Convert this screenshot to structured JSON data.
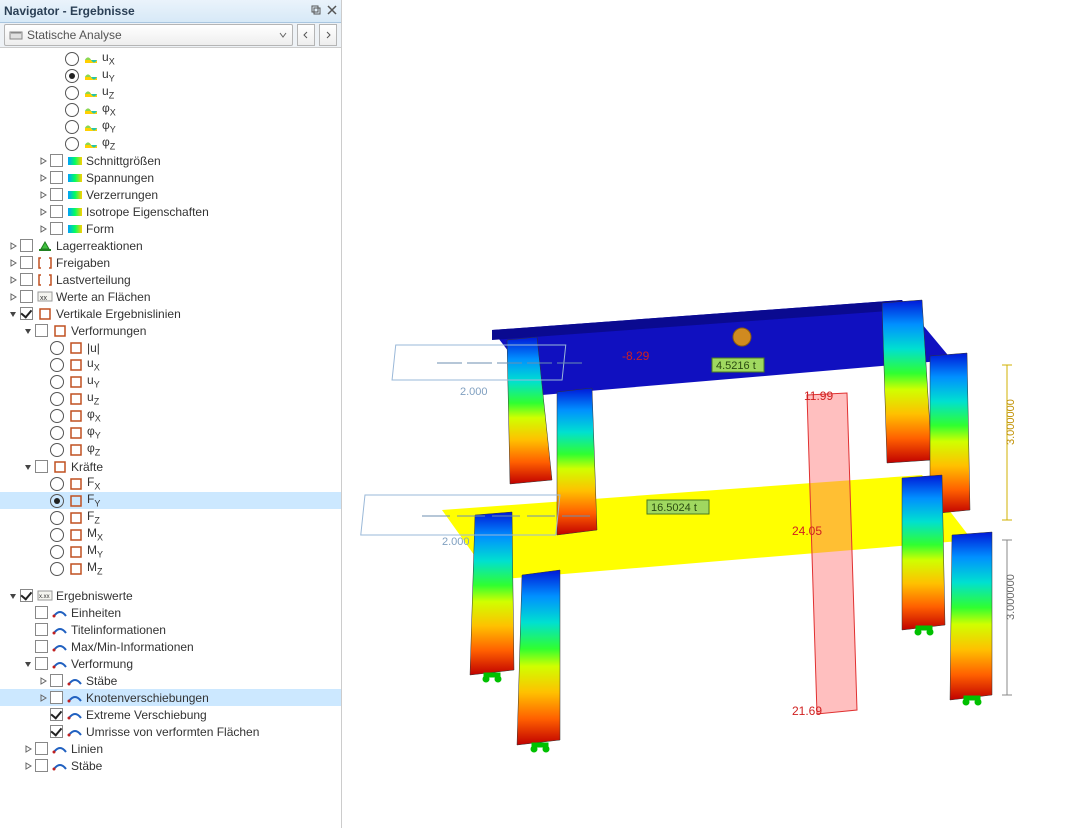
{
  "panel": {
    "title": "Navigator - Ergebnisse",
    "dropdown": "Statische Analyse"
  },
  "tree": [
    {
      "type": "radio",
      "indent": 3,
      "label": "u",
      "sub": "X"
    },
    {
      "type": "radio",
      "indent": 3,
      "label": "u",
      "sub": "Y",
      "radioChecked": true
    },
    {
      "type": "radio",
      "indent": 3,
      "label": "u",
      "sub": "Z"
    },
    {
      "type": "radio",
      "indent": 3,
      "label": "φ",
      "sub": "X"
    },
    {
      "type": "radio",
      "indent": 3,
      "label": "φ",
      "sub": "Y"
    },
    {
      "type": "radio",
      "indent": 3,
      "label": "φ",
      "sub": "Z"
    },
    {
      "type": "check",
      "indent": 2,
      "expander": "closed",
      "label": "Schnittgrößen",
      "icon": "gradient"
    },
    {
      "type": "check",
      "indent": 2,
      "expander": "closed",
      "label": "Spannungen",
      "icon": "gradient"
    },
    {
      "type": "check",
      "indent": 2,
      "expander": "closed",
      "label": "Verzerrungen",
      "icon": "gradient"
    },
    {
      "type": "check",
      "indent": 2,
      "expander": "closed",
      "label": "Isotrope Eigenschaften",
      "icon": "gradient"
    },
    {
      "type": "check",
      "indent": 2,
      "expander": "closed",
      "label": "Form",
      "icon": "gradient"
    },
    {
      "type": "check",
      "indent": 0,
      "expander": "closed",
      "label": "Lagerreaktionen",
      "icon": "support"
    },
    {
      "type": "check",
      "indent": 0,
      "expander": "closed",
      "label": "Freigaben",
      "icon": "brackets"
    },
    {
      "type": "check",
      "indent": 0,
      "expander": "closed",
      "label": "Lastverteilung",
      "icon": "brackets"
    },
    {
      "type": "check",
      "indent": 0,
      "expander": "closed",
      "label": "Werte an Flächen",
      "icon": "xx"
    },
    {
      "type": "check",
      "indent": 0,
      "expander": "open",
      "label": "Vertikale Ergebnislinien",
      "icon": "bracket",
      "checked": true
    },
    {
      "type": "check",
      "indent": 1,
      "expander": "open",
      "label": "Verformungen",
      "icon": "bracket"
    },
    {
      "type": "radio",
      "indent": 2,
      "label": "|u|",
      "icon": "bracket"
    },
    {
      "type": "radio",
      "indent": 2,
      "label": "u",
      "sub": "X",
      "icon": "bracket"
    },
    {
      "type": "radio",
      "indent": 2,
      "label": "u",
      "sub": "Y",
      "icon": "bracket"
    },
    {
      "type": "radio",
      "indent": 2,
      "label": "u",
      "sub": "Z",
      "icon": "bracket"
    },
    {
      "type": "radio",
      "indent": 2,
      "label": "φ",
      "sub": "X",
      "icon": "bracket"
    },
    {
      "type": "radio",
      "indent": 2,
      "label": "φ",
      "sub": "Y",
      "icon": "bracket"
    },
    {
      "type": "radio",
      "indent": 2,
      "label": "φ",
      "sub": "Z",
      "icon": "bracket"
    },
    {
      "type": "check",
      "indent": 1,
      "expander": "open",
      "label": "Kräfte",
      "icon": "bracket"
    },
    {
      "type": "radio",
      "indent": 2,
      "label": "F",
      "sub": "X",
      "icon": "bracket"
    },
    {
      "type": "radio",
      "indent": 2,
      "label": "F",
      "sub": "Y",
      "icon": "bracket",
      "radioChecked": true,
      "selected": true
    },
    {
      "type": "radio",
      "indent": 2,
      "label": "F",
      "sub": "Z",
      "icon": "bracket"
    },
    {
      "type": "radio",
      "indent": 2,
      "label": "M",
      "sub": "X",
      "icon": "bracket"
    },
    {
      "type": "radio",
      "indent": 2,
      "label": "M",
      "sub": "Y",
      "icon": "bracket"
    },
    {
      "type": "radio",
      "indent": 2,
      "label": "M",
      "sub": "Z",
      "icon": "bracket"
    },
    {
      "gap": true
    },
    {
      "type": "check",
      "indent": 0,
      "expander": "open",
      "label": "Ergebniswerte",
      "icon": "xxx",
      "checked": true
    },
    {
      "type": "check",
      "indent": 1,
      "label": "Einheiten",
      "icon": "swoosh"
    },
    {
      "type": "check",
      "indent": 1,
      "label": "Titelinformationen",
      "icon": "swoosh"
    },
    {
      "type": "check",
      "indent": 1,
      "label": "Max/Min-Informationen",
      "icon": "swoosh"
    },
    {
      "type": "check",
      "indent": 1,
      "expander": "open",
      "label": "Verformung",
      "icon": "swoosh"
    },
    {
      "type": "check",
      "indent": 2,
      "expander": "closed",
      "label": "Stäbe",
      "icon": "swoosh"
    },
    {
      "type": "check",
      "indent": 2,
      "expander": "closed",
      "label": "Knotenverschiebungen",
      "icon": "swoosh",
      "selected": true
    },
    {
      "type": "check",
      "indent": 2,
      "label": "Extreme Verschiebung",
      "icon": "swoosh",
      "checked": true
    },
    {
      "type": "check",
      "indent": 2,
      "label": "Umrisse von verformten Flächen",
      "icon": "swoosh",
      "checked": true
    },
    {
      "type": "check",
      "indent": 1,
      "expander": "closed",
      "label": "Linien",
      "icon": "swoosh"
    },
    {
      "type": "check",
      "indent": 1,
      "expander": "closed",
      "label": "Stäbe",
      "icon": "swoosh"
    }
  ],
  "model": {
    "annotations": {
      "top_value": "-8.29",
      "top_label": "4.5216 t",
      "mid_label": "16.5024 t",
      "r1": "11.99",
      "r2": "24.05",
      "r3": "21.69",
      "dim_upper": "3.000000",
      "dim_lower": "3.000000",
      "left_upper": "2.000",
      "left_lower": "2.000"
    }
  }
}
